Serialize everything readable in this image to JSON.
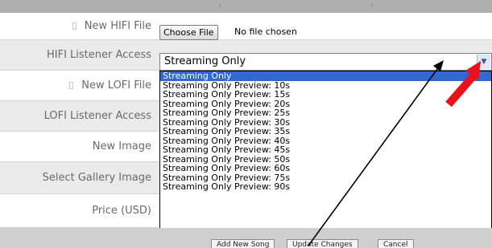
{
  "form": {
    "rows": [
      {
        "label": "New HIFI File",
        "has_dot": true
      },
      {
        "label": "HIFI Listener Access",
        "has_dot": false
      },
      {
        "label": "New LOFI File",
        "has_dot": true
      },
      {
        "label": "LOFI Listener Access",
        "has_dot": false
      },
      {
        "label": "New Image",
        "has_dot": false
      },
      {
        "label": "Select Gallery Image",
        "has_dot": false
      },
      {
        "label": "Price (USD)",
        "has_dot": false
      }
    ],
    "hifi_file": {
      "button_label": "Choose File",
      "status": "No file chosen"
    },
    "hifi_access": {
      "selected": "Streaming Only",
      "arrow_icon": "chevron-down-icon",
      "options": [
        "Streaming Only",
        "Streaming Only Preview: 10s",
        "Streaming Only Preview: 15s",
        "Streaming Only Preview: 20s",
        "Streaming Only Preview: 25s",
        "Streaming Only Preview: 30s",
        "Streaming Only Preview: 35s",
        "Streaming Only Preview: 40s",
        "Streaming Only Preview: 45s",
        "Streaming Only Preview: 50s",
        "Streaming Only Preview: 60s",
        "Streaming Only Preview: 75s",
        "Streaming Only Preview: 90s"
      ]
    }
  },
  "footer": {
    "add_label": "Add New Song",
    "update_label": "Update Changes",
    "cancel_label": "Cancel"
  },
  "colors": {
    "highlight": "#3168d5",
    "annotation_arrow": "#e8121a"
  }
}
